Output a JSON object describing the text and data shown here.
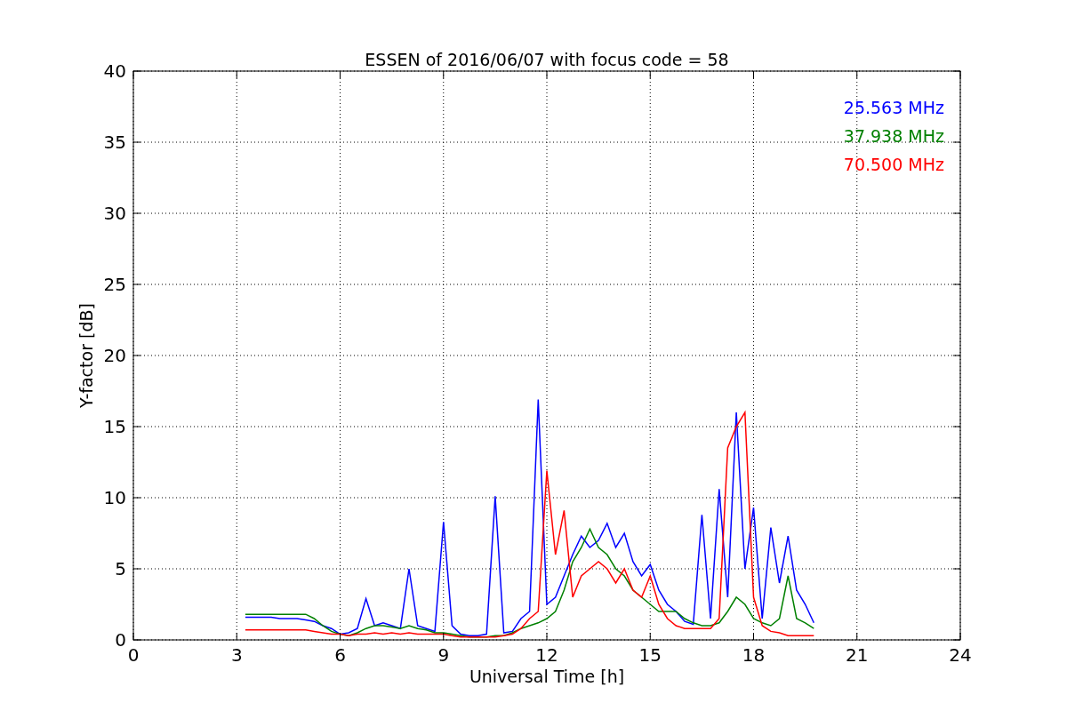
{
  "chart_data": {
    "type": "line",
    "title": "ESSEN of 2016/06/07 with focus code = 58",
    "xlabel": "Universal Time [h]",
    "ylabel": "Y-factor [dB]",
    "grid": true,
    "xlim": [
      0,
      24
    ],
    "ylim": [
      0,
      40
    ],
    "xticks": [
      0,
      3,
      6,
      9,
      12,
      15,
      18,
      21,
      24
    ],
    "yticks": [
      0,
      5,
      10,
      15,
      20,
      25,
      30,
      35,
      40
    ],
    "x": [
      3.25,
      3.5,
      3.75,
      4,
      4.25,
      4.5,
      4.75,
      5,
      5.25,
      5.5,
      5.75,
      6,
      6.25,
      6.5,
      6.75,
      7,
      7.25,
      7.5,
      7.75,
      8,
      8.25,
      8.5,
      8.75,
      9,
      9.25,
      9.5,
      9.75,
      10,
      10.25,
      10.5,
      10.75,
      11,
      11.25,
      11.5,
      11.75,
      12,
      12.25,
      12.5,
      12.75,
      13,
      13.25,
      13.5,
      13.75,
      14,
      14.25,
      14.5,
      14.75,
      15,
      15.25,
      15.5,
      15.75,
      16,
      16.25,
      16.5,
      16.75,
      17,
      17.25,
      17.5,
      17.75,
      18,
      18.25,
      18.5,
      18.75,
      19,
      19.25,
      19.5,
      19.75
    ],
    "series": [
      {
        "name": "25.563 MHz",
        "color": "#0000ff",
        "values": [
          1.6,
          1.6,
          1.6,
          1.6,
          1.5,
          1.5,
          1.5,
          1.4,
          1.3,
          1.0,
          0.8,
          0.4,
          0.5,
          0.8,
          2.9,
          1.0,
          1.2,
          1.0,
          0.8,
          5.0,
          1.0,
          0.8,
          0.6,
          8.3,
          1.0,
          0.4,
          0.3,
          0.3,
          0.4,
          10.1,
          0.5,
          0.6,
          1.5,
          2.0,
          16.9,
          2.5,
          3.0,
          4.5,
          6.0,
          7.3,
          6.5,
          7.0,
          8.2,
          6.5,
          7.5,
          5.5,
          4.5,
          5.3,
          3.5,
          2.5,
          2.0,
          1.3,
          1.1,
          8.8,
          1.5,
          10.6,
          3.0,
          16.0,
          5.0,
          9.3,
          1.5,
          7.9,
          4.0,
          7.3,
          3.5,
          2.5,
          1.2
        ]
      },
      {
        "name": "37.938 MHz",
        "color": "#008000",
        "values": [
          1.8,
          1.8,
          1.8,
          1.8,
          1.8,
          1.8,
          1.8,
          1.8,
          1.5,
          1.0,
          0.6,
          0.4,
          0.3,
          0.5,
          0.8,
          1.0,
          1.0,
          0.9,
          0.8,
          1.0,
          0.8,
          0.7,
          0.5,
          0.5,
          0.4,
          0.3,
          0.2,
          0.2,
          0.2,
          0.3,
          0.3,
          0.5,
          0.8,
          1.0,
          1.2,
          1.5,
          2.0,
          3.5,
          5.5,
          6.5,
          7.8,
          6.5,
          6.0,
          5.0,
          4.5,
          3.5,
          3.0,
          2.5,
          2.0,
          2.0,
          2.0,
          1.5,
          1.2,
          1.0,
          1.0,
          1.2,
          2.0,
          3.0,
          2.5,
          1.5,
          1.2,
          1.0,
          1.5,
          4.5,
          1.5,
          1.2,
          0.8
        ]
      },
      {
        "name": "70.500 MHz",
        "color": "#ff0000",
        "values": [
          0.7,
          0.7,
          0.7,
          0.7,
          0.7,
          0.7,
          0.7,
          0.7,
          0.6,
          0.5,
          0.4,
          0.4,
          0.3,
          0.4,
          0.4,
          0.5,
          0.4,
          0.5,
          0.4,
          0.5,
          0.4,
          0.4,
          0.4,
          0.4,
          0.3,
          0.2,
          0.2,
          0.2,
          0.2,
          0.2,
          0.3,
          0.4,
          0.8,
          1.5,
          2.0,
          11.9,
          6.0,
          9.1,
          3.0,
          4.5,
          5.0,
          5.5,
          5.0,
          4.0,
          5.0,
          3.5,
          3.0,
          4.5,
          2.5,
          1.5,
          1.0,
          0.8,
          0.8,
          0.8,
          0.8,
          1.5,
          13.5,
          15.0,
          16.0,
          3.0,
          1.0,
          0.6,
          0.5,
          0.3,
          0.3,
          0.3,
          0.3
        ]
      }
    ]
  }
}
